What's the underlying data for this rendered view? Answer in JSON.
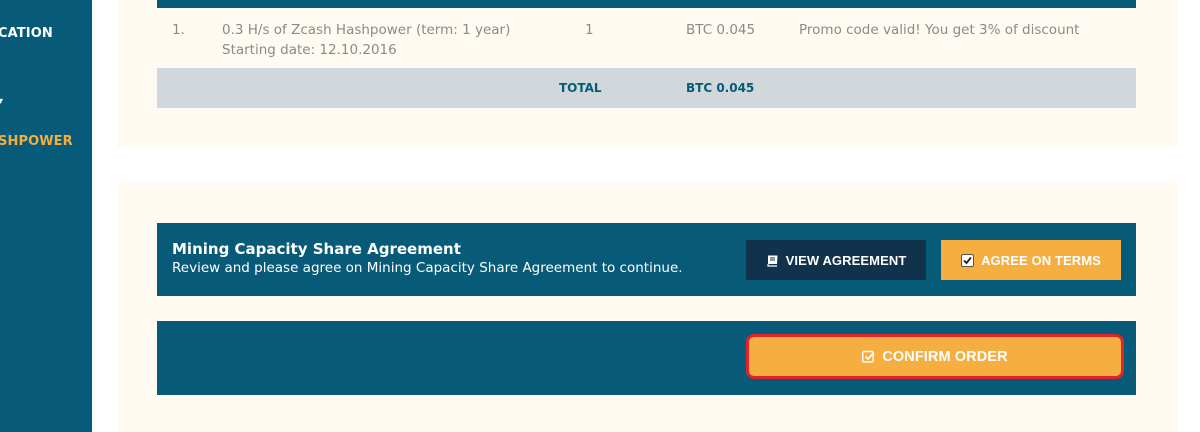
{
  "sidebar": {
    "items": [
      {
        "label": "CATION"
      },
      {
        "label": "▾"
      },
      {
        "label": "SHPOWER"
      }
    ]
  },
  "order": {
    "row": {
      "number": "1.",
      "description_line1": "0.3  H/s of Zcash Hashpower (term: 1 year)",
      "description_line2": "Starting date: 12.10.2016",
      "quantity": "1",
      "price": "BTC 0.045",
      "note": "Promo code valid! You get 3% of discount"
    },
    "total_label": "TOTAL",
    "total_value": "BTC 0.045"
  },
  "agreement": {
    "title": "Mining Capacity Share Agreement",
    "subtitle": "Review and please agree on Mining Capacity Share Agreement to continue.",
    "view_label": "VIEW AGREEMENT",
    "agree_label": "AGREE ON TERMS"
  },
  "confirm": {
    "label": "CONFIRM ORDER"
  },
  "colors": {
    "primary": "#075a78",
    "accent": "#f5ae3f",
    "dark_button": "#11324b",
    "panel_bg": "#fffbf2",
    "total_bg": "#d1d8dc",
    "highlight_border": "#e0242e"
  },
  "icons": {
    "view": "book-icon",
    "agree": "checkbox-checked-icon",
    "confirm": "check-square-icon"
  }
}
